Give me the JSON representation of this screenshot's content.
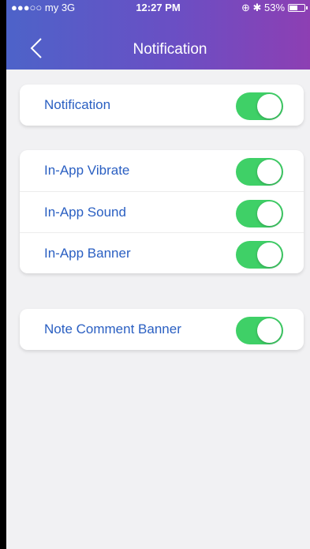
{
  "status_bar": {
    "carrier": "●●●○○ my  3G",
    "time": "12:27 PM",
    "right": "⊕ ✱ 53%"
  },
  "nav": {
    "title": "Notification",
    "back_icon": "chevron-left-icon"
  },
  "groups": [
    {
      "items": [
        {
          "label": "Notification",
          "on": true
        }
      ]
    },
    {
      "items": [
        {
          "label": "In-App Vibrate",
          "on": true
        },
        {
          "label": "In-App Sound",
          "on": true
        },
        {
          "label": "In-App Banner",
          "on": true
        }
      ]
    },
    {
      "items": [
        {
          "label": "Note Comment Banner",
          "on": true
        }
      ]
    }
  ],
  "colors": {
    "accent_text": "#2a5fc2",
    "toggle_on": "#3fd067",
    "header_gradient_start": "#4d63c9",
    "header_gradient_end": "#8d3fb3"
  }
}
